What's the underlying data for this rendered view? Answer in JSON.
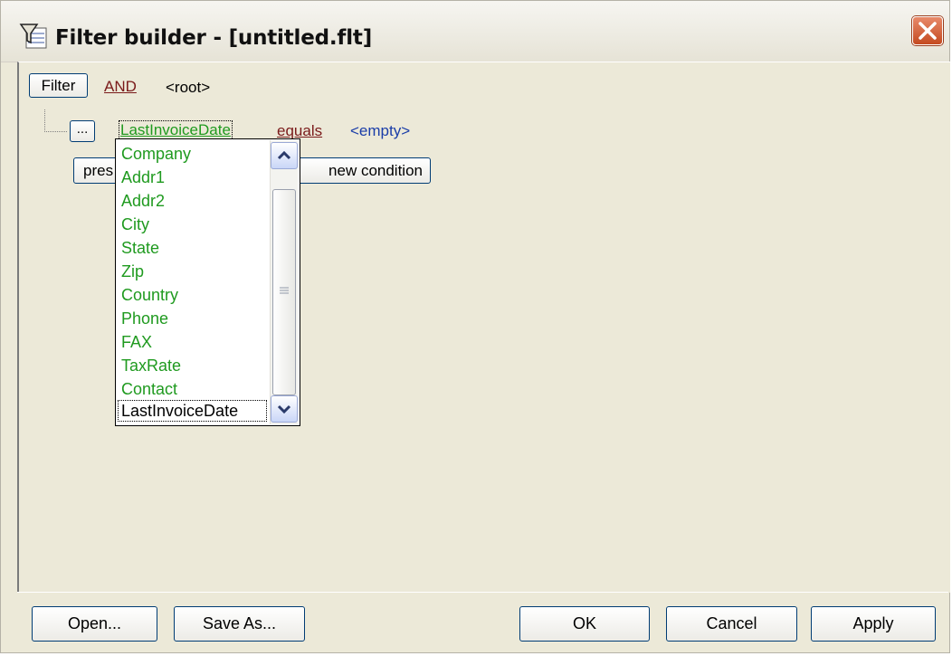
{
  "window": {
    "title": "Filter builder - [untitled.flt]"
  },
  "filter": {
    "filter_button": "Filter",
    "operator": "AND",
    "root_label": "<root>"
  },
  "condition": {
    "ellipsis_button": "...",
    "field": "LastInvoiceDate",
    "comparison": "equals",
    "value": "<empty>"
  },
  "row2": {
    "press_button_partial": "pres",
    "new_condition_button_partial": "new condition"
  },
  "field_dropdown": {
    "items": [
      "Company",
      "Addr1",
      "Addr2",
      "City",
      "State",
      "Zip",
      "Country",
      "Phone",
      "FAX",
      "TaxRate",
      "Contact",
      "LastInvoiceDate"
    ],
    "selected": "LastInvoiceDate"
  },
  "footer": {
    "open": "Open...",
    "save_as": "Save As...",
    "ok": "OK",
    "cancel": "Cancel",
    "apply": "Apply"
  },
  "colors": {
    "field_link": "#1f9a1f",
    "comparison_link": "#7a1a1a",
    "value_link": "#1a3da8",
    "dialog_bg": "#ece9d8"
  }
}
